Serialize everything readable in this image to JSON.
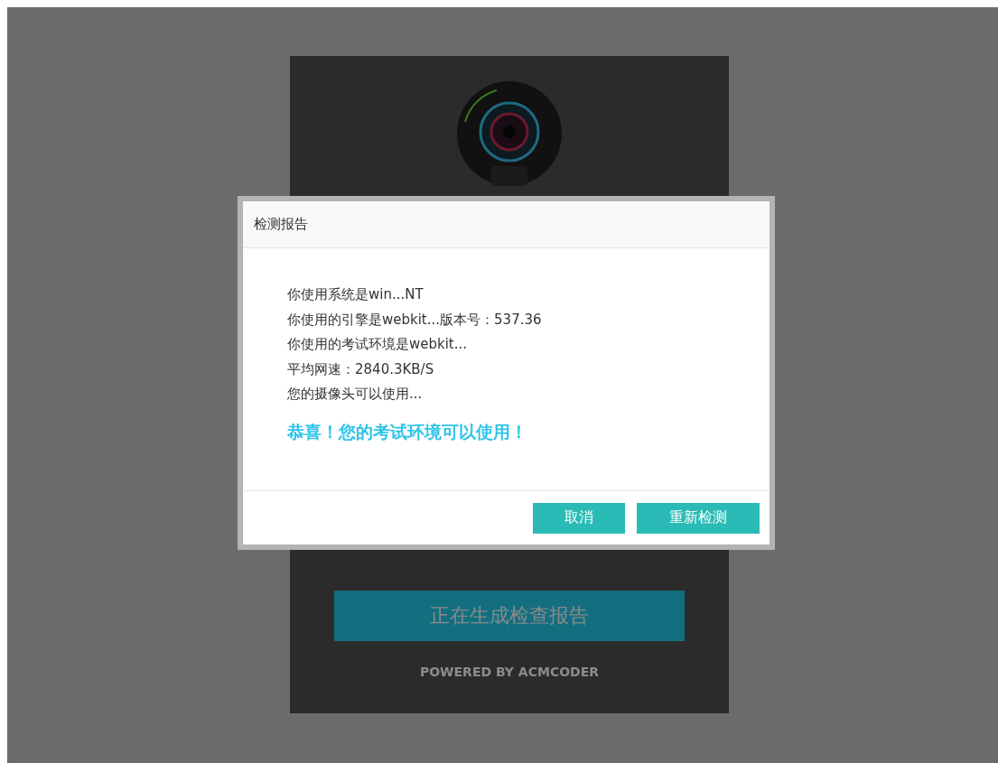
{
  "background_panel": {
    "progress_button": "正在生成检查报告",
    "footer": "POWERED BY ACMCODER"
  },
  "dialog": {
    "title": "检测报告",
    "lines": [
      {
        "kind": "info",
        "text": "你使用系统是win...NT"
      },
      {
        "kind": "info",
        "text": "你使用的引擎是webkit...版本号：537.36"
      },
      {
        "kind": "info",
        "text": "你使用的考试环境是webkit..."
      },
      {
        "kind": "info",
        "text": "平均网速：2840.3KB/S"
      },
      {
        "kind": "info",
        "text": "您的摄像头可以使用..."
      },
      {
        "kind": "success",
        "text": "恭喜！您的考试环境可以使用！"
      }
    ],
    "buttons": [
      "取消",
      "重新检测"
    ]
  }
}
